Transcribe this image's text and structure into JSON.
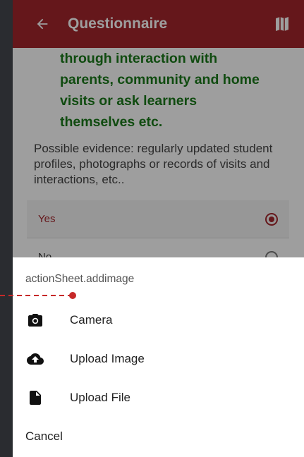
{
  "header": {
    "title": "Questionnaire",
    "back_icon": "arrow-left-icon",
    "map_icon": "map-icon",
    "color": "#a4262c"
  },
  "question": {
    "lines": [
      "through interaction with",
      "parents, community and home",
      "visits or ask learners",
      "themselves etc."
    ],
    "color": "#1a7a1a"
  },
  "evidence": {
    "text": "Possible evidence: regularly updated student profiles, photographs or records of visits and interactions, etc.."
  },
  "options": [
    {
      "label": "Yes",
      "selected": true
    },
    {
      "label": "No",
      "selected": false
    }
  ],
  "action_sheet": {
    "title": "actionSheet.addimage",
    "items": [
      {
        "label": "Camera",
        "icon": "camera-icon"
      },
      {
        "label": "Upload Image",
        "icon": "cloud-upload-icon"
      },
      {
        "label": "Upload File",
        "icon": "file-icon"
      }
    ],
    "cancel": "Cancel"
  },
  "annotation_color": "#c62828"
}
